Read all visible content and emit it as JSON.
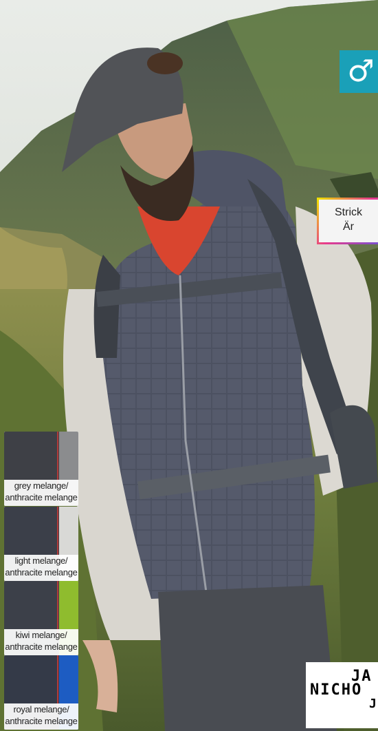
{
  "badge": {
    "symbol": "♂",
    "color": "#1aa0b8",
    "icon": "male-symbol-icon"
  },
  "feature": {
    "line1": "Strick",
    "line2": "Är"
  },
  "swatches": [
    {
      "line1": "grey melange/",
      "line2": "anthracite melange",
      "sleeve": "#8b8c8e",
      "body": "#3e4046"
    },
    {
      "line1": "light melange/",
      "line2": "anthracite melange",
      "sleeve": "#d9d9d6",
      "body": "#3b3f49"
    },
    {
      "line1": "kiwi melange/",
      "line2": "anthracite melange",
      "sleeve": "#8fbc2e",
      "body": "#3c4049"
    },
    {
      "line1": "royal melange/",
      "line2": "anthracite melange",
      "sleeve": "#1d5cc2",
      "body": "#343a48"
    }
  ],
  "logo": {
    "line1": "JA",
    "line2": "NICHO",
    "line3": "J"
  }
}
